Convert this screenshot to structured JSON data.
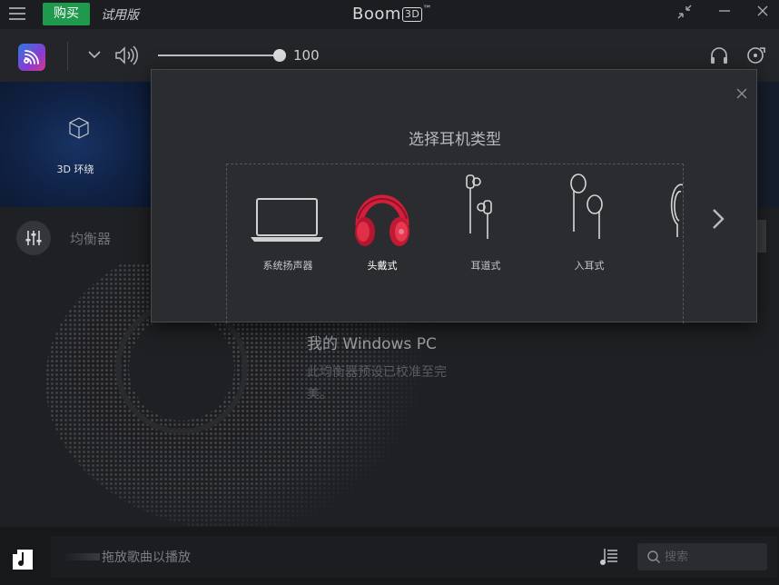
{
  "titlebar": {
    "buy_label": "购买",
    "trial_label": "试用版",
    "app_name": "Boom",
    "app_badge": "3D",
    "trademark": "™"
  },
  "toolbar": {
    "volume": 100,
    "volume_label": "100"
  },
  "effects": {
    "items": [
      {
        "label": "3D 环绕"
      }
    ]
  },
  "main": {
    "equalizer_label": "均衡器",
    "preset_title": "我的 Windows PC",
    "preset_desc": "此均衡器预设已校准至完美。"
  },
  "bottom": {
    "drop_text": "拖放歌曲以播放",
    "search_placeholder": "搜索"
  },
  "dialog": {
    "title": "选择耳机类型",
    "items": [
      {
        "label": "系统扬声器",
        "icon": "laptop-icon",
        "selected": false
      },
      {
        "label": "头戴式",
        "icon": "over-ear-headphones-icon",
        "selected": true
      },
      {
        "label": "耳道式",
        "icon": "in-ear-canal-icon",
        "selected": false
      },
      {
        "label": "入耳式",
        "icon": "earbuds-icon",
        "selected": false
      }
    ]
  },
  "colors": {
    "accent_red": "#d41f3c",
    "buy_green": "#1f9a4d"
  }
}
